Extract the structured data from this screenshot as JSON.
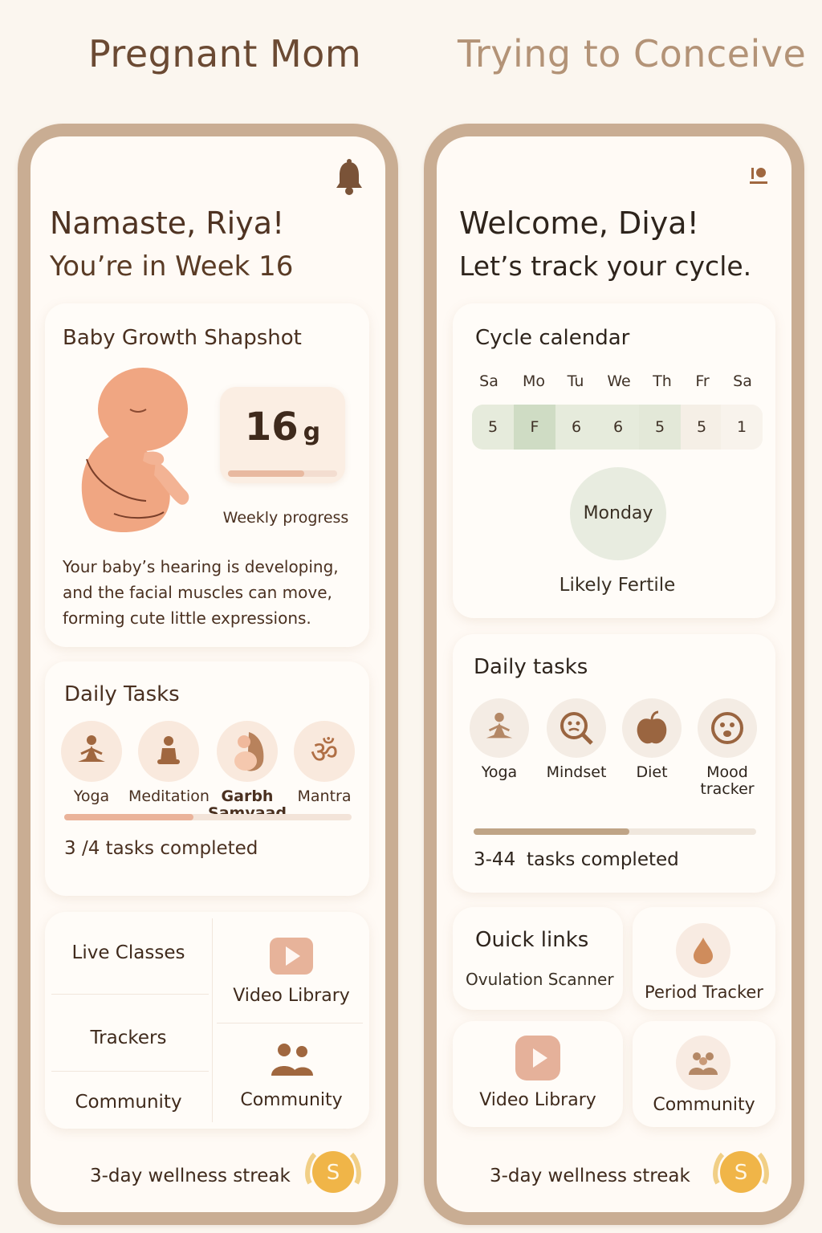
{
  "headings": {
    "left": "Pregnant Mom",
    "right": "Trying to Conceive"
  },
  "colors": {
    "accent_peach": "#e8b9a0",
    "accent_tan": "#b89b7f",
    "frame": "#c9ad93",
    "streak_gold": "#f0b548"
  },
  "pregnant": {
    "greeting": "Namaste, Riya!",
    "subtitle": "You’re in Week 16",
    "notification_icon": "bell-icon",
    "snapshot": {
      "title": "Baby Growth Shapshot",
      "weight_value": "16",
      "weight_unit": "g",
      "weekly_progress_fraction": 0.7,
      "weekly_progress_label": "Weekly progress",
      "description": "Your baby’s hearing is developing, and the facial muscles can move, forming cute little expressions."
    },
    "tasks": {
      "title": "Daily Tasks",
      "items": [
        {
          "label": "Yoga",
          "icon": "yoga-icon"
        },
        {
          "label": "Meditation",
          "icon": "meditation-icon"
        },
        {
          "label": "Garbh Samvaad",
          "icon": "mother-baby-icon"
        },
        {
          "label": "Mantra",
          "icon": "om-icon"
        }
      ],
      "progress_fraction": 0.45,
      "completed_text": "3 /4 tasks completed"
    },
    "links": {
      "live_classes": "Live Classes",
      "trackers": "Trackers",
      "community_left": "Community",
      "video_library": "Video Library",
      "community_right": "Community"
    },
    "streak": {
      "text": "3-day wellness streak",
      "badge": "S"
    }
  },
  "conceive": {
    "greeting": "Welcome, Diya!",
    "subtitle": "Let’s track your cycle.",
    "profile_icon": "profile-icon",
    "calendar": {
      "title": "Cycle calendar",
      "days": [
        "Sa",
        "Mo",
        "Tu",
        "We",
        "Th",
        "Fr",
        "Sa"
      ],
      "dates": [
        "5",
        "F",
        "6",
        "6",
        "5",
        "5",
        "1"
      ],
      "selected_day": "Monday",
      "status": "Likely Fertile"
    },
    "tasks": {
      "title": "Daily tasks",
      "items": [
        {
          "label": "Yoga",
          "icon": "yoga-icon"
        },
        {
          "label": "Mindset",
          "icon": "mindset-icon"
        },
        {
          "label": "Diet",
          "icon": "apple-icon"
        },
        {
          "label": "Mood tracker",
          "icon": "mood-face-icon"
        }
      ],
      "progress_fraction": 0.55,
      "completed_number": "3-44",
      "completed_text": "tasks completed"
    },
    "quick_links": {
      "title": "Ouick links",
      "ovulation": "Ovulation Scanner",
      "period": "Period Tracker",
      "video": "Video Library",
      "community": "Community"
    },
    "streak": {
      "text": "3-day wellness streak",
      "badge": "S"
    }
  }
}
